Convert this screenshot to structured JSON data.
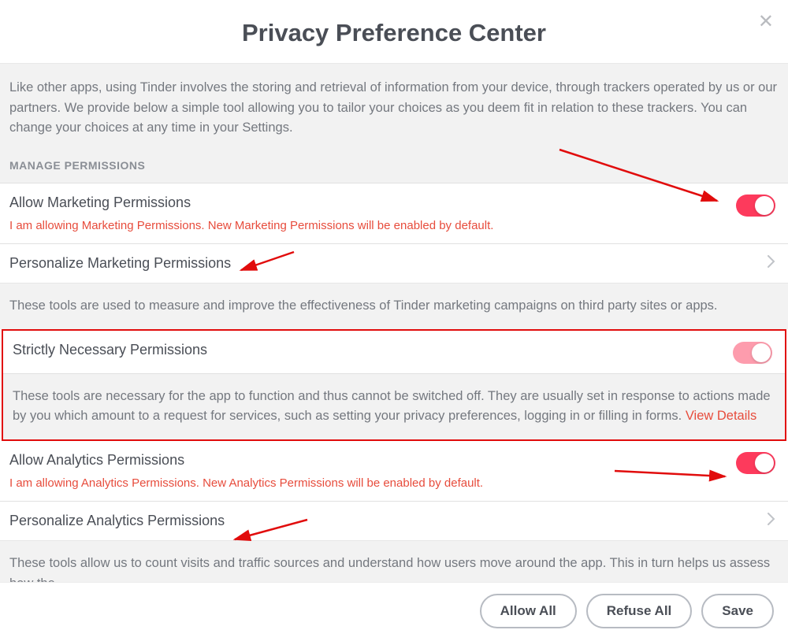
{
  "header": {
    "title": "Privacy Preference Center",
    "close_label": "✕"
  },
  "intro": {
    "text": "Like other apps, using Tinder involves the storing and retrieval of information from your device, through trackers operated by us or our partners. We provide below a simple tool allowing you to tailor your choices as you deem fit in relation to these trackers. You can change your choices at any time in your Settings."
  },
  "section_label": "MANAGE PERMISSIONS",
  "marketing": {
    "title": "Allow Marketing Permissions",
    "status": "I am allowing Marketing Permissions. New Marketing Permissions will be enabled by default.",
    "toggle_on": true,
    "personalize_title": "Personalize Marketing Permissions",
    "description": "These tools are used to measure and improve the effectiveness of Tinder marketing campaigns on third party sites or apps."
  },
  "strictly": {
    "title": "Strictly Necessary Permissions",
    "toggle_on": true,
    "toggle_disabled": true,
    "desc_text": "These tools are necessary for the app to function and thus cannot be switched off. They are usually set in response to actions made by you which amount to a request for services, such as setting your privacy preferences, logging in or filling in forms. ",
    "view_details": "View Details"
  },
  "analytics": {
    "title": "Allow Analytics Permissions",
    "status": "I am allowing Analytics Permissions. New Analytics Permissions will be enabled by default.",
    "toggle_on": true,
    "personalize_title": "Personalize Analytics Permissions",
    "description": "These tools allow us to count visits and traffic sources and understand how users move around the app. This in turn helps us assess how the"
  },
  "footer": {
    "allow_all": "Allow All",
    "refuse_all": "Refuse All",
    "save": "Save"
  }
}
